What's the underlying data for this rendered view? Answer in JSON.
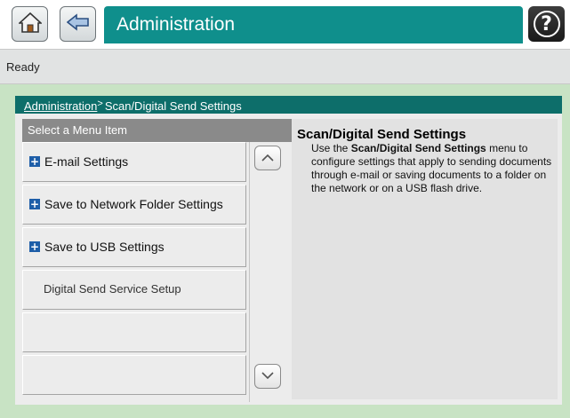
{
  "header": {
    "title": "Administration",
    "home_icon": "home-icon",
    "back_icon": "back-arrow-icon",
    "help_icon": "help-icon",
    "help_glyph": "?",
    "accent_color": "#0f8f8c"
  },
  "status": {
    "text": "Ready"
  },
  "breadcrumb": {
    "root": "Administration",
    "separator": ">",
    "current": "Scan/Digital Send Settings"
  },
  "menu": {
    "header": "Select a Menu Item",
    "items": [
      {
        "label": "E-mail Settings",
        "expandable": true
      },
      {
        "label": "Save to Network Folder Settings",
        "expandable": true
      },
      {
        "label": "Save to USB Settings",
        "expandable": true
      },
      {
        "label": "Digital Send Service Setup",
        "expandable": false
      },
      {
        "label": "",
        "expandable": false
      },
      {
        "label": "",
        "expandable": false
      }
    ]
  },
  "description": {
    "title": "Scan/Digital Send Settings",
    "prefix": "Use the ",
    "bold": "Scan/Digital Send Settings",
    "suffix": " menu to configure settings that apply to sending documents through e-mail or saving documents to a folder on the network or on a USB flash drive."
  }
}
